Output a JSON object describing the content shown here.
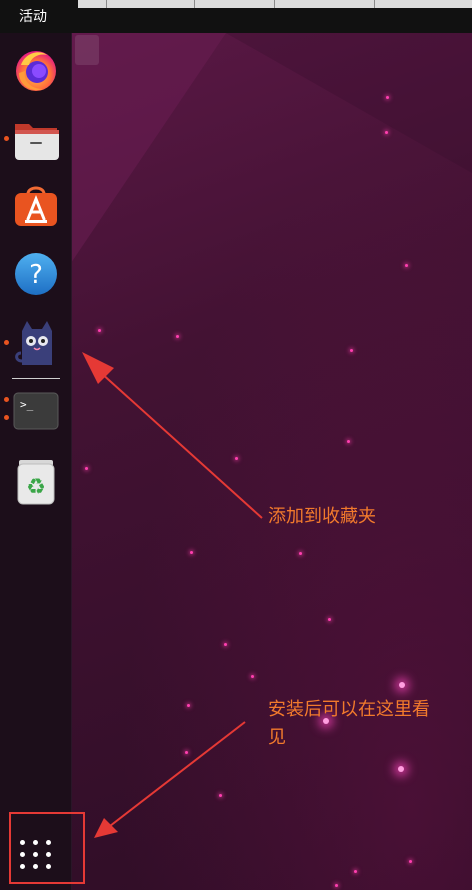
{
  "topbar": {
    "activities_label": "活动"
  },
  "dock": {
    "items": [
      {
        "name": "Firefox",
        "icon": "firefox-icon",
        "running": false
      },
      {
        "name": "Files",
        "icon": "folder-icon",
        "running": true
      },
      {
        "name": "Ubuntu Software",
        "icon": "software-store-icon",
        "running": false
      },
      {
        "name": "Help",
        "icon": "help-icon",
        "running": false
      },
      {
        "name": "Cat app",
        "icon": "cat-icon",
        "running": true
      },
      {
        "name": "Terminal",
        "icon": "terminal-icon",
        "running": true,
        "glyph": ">_"
      },
      {
        "name": "Trash",
        "icon": "trash-icon",
        "running": false,
        "glyph": "♻"
      }
    ],
    "show_apps_icon": "apps-grid-icon",
    "help_glyph": "?"
  },
  "annotations": {
    "favorites_note": "添加到收藏夹",
    "installed_note_line1": "安装后可以在这里看",
    "installed_note_line2": "见"
  },
  "colors": {
    "annotation": "#f27a2c",
    "arrow": "#e53935",
    "running_indicator": "#e95420",
    "desktop": "#431233"
  }
}
